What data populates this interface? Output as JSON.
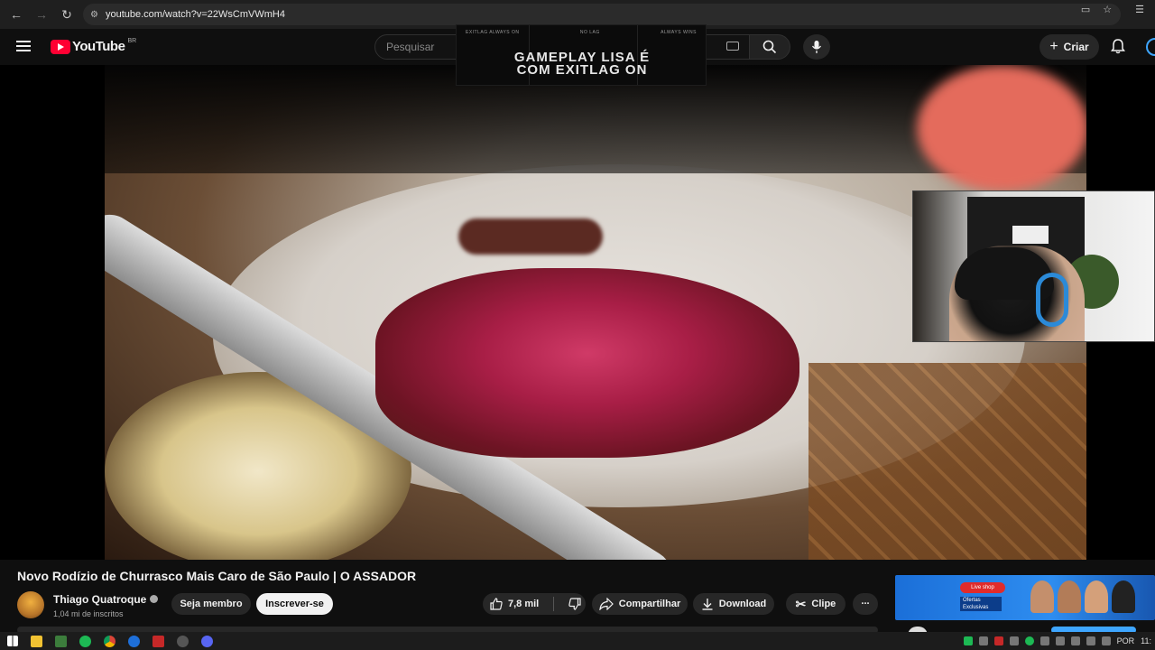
{
  "browser": {
    "url": "youtube.com/watch?v=22WsCmVWmH4",
    "nav_icons": [
      "back-arrow-icon",
      "forward-arrow-icon",
      "reload-icon"
    ],
    "right_icons": [
      "cast-icon",
      "bookmark-star-icon",
      "reading-list-icon"
    ]
  },
  "header": {
    "logo_text": "YouTube",
    "region": "BR",
    "search_placeholder": "Pesquisar",
    "create_label": "Criar"
  },
  "overlay_banner": {
    "line1": "GAMEPLAY LISA É",
    "line2": "COM EXITLAG ON",
    "tags": [
      "EXITLAG ALWAYS ON",
      "NO LAG",
      "ALWAYS WINS"
    ]
  },
  "video": {
    "title": "Novo Rodízio de Churrasco Mais Caro de São Paulo | O ASSADOR"
  },
  "channel": {
    "name": "Thiago Quatroque",
    "subscribers": "1,04 mi de inscritos",
    "member_label": "Seja membro",
    "subscribe_label": "Inscrever-se"
  },
  "actions": {
    "likes": "7,8 mil",
    "share_label": "Compartilhar",
    "download_label": "Download",
    "clip_label": "Clipe",
    "more_label": "..."
  },
  "ad": {
    "badge": "Live shop",
    "sub_badge": "Ofertas Exclusivas"
  },
  "taskbar": {
    "language": "POR",
    "clock": "11:"
  },
  "colors": {
    "accent_red": "#ff0033",
    "link_blue": "#3ea6ff",
    "background": "#0f0f0f"
  }
}
